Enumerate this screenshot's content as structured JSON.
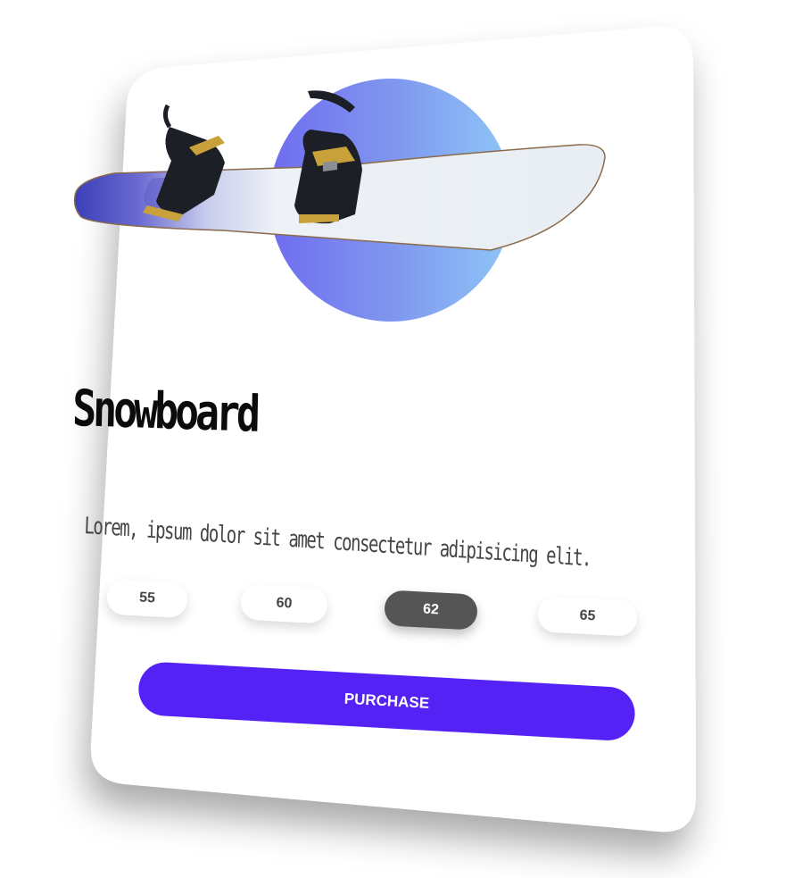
{
  "product": {
    "title": "Snowboard",
    "description": "Lorem, ipsum dolor sit amet consectetur adipisicing elit."
  },
  "sizes": [
    {
      "label": "55",
      "selected": false
    },
    {
      "label": "60",
      "selected": false
    },
    {
      "label": "62",
      "selected": true
    },
    {
      "label": "65",
      "selected": false
    }
  ],
  "purchase_label": "PURCHASE",
  "icons": {
    "product_image": "snowboard-image"
  },
  "colors": {
    "accent": "#5522f5",
    "selected_size": "#555555",
    "gradient_start": "#6f6cf0",
    "gradient_end": "#8ec6f6"
  }
}
